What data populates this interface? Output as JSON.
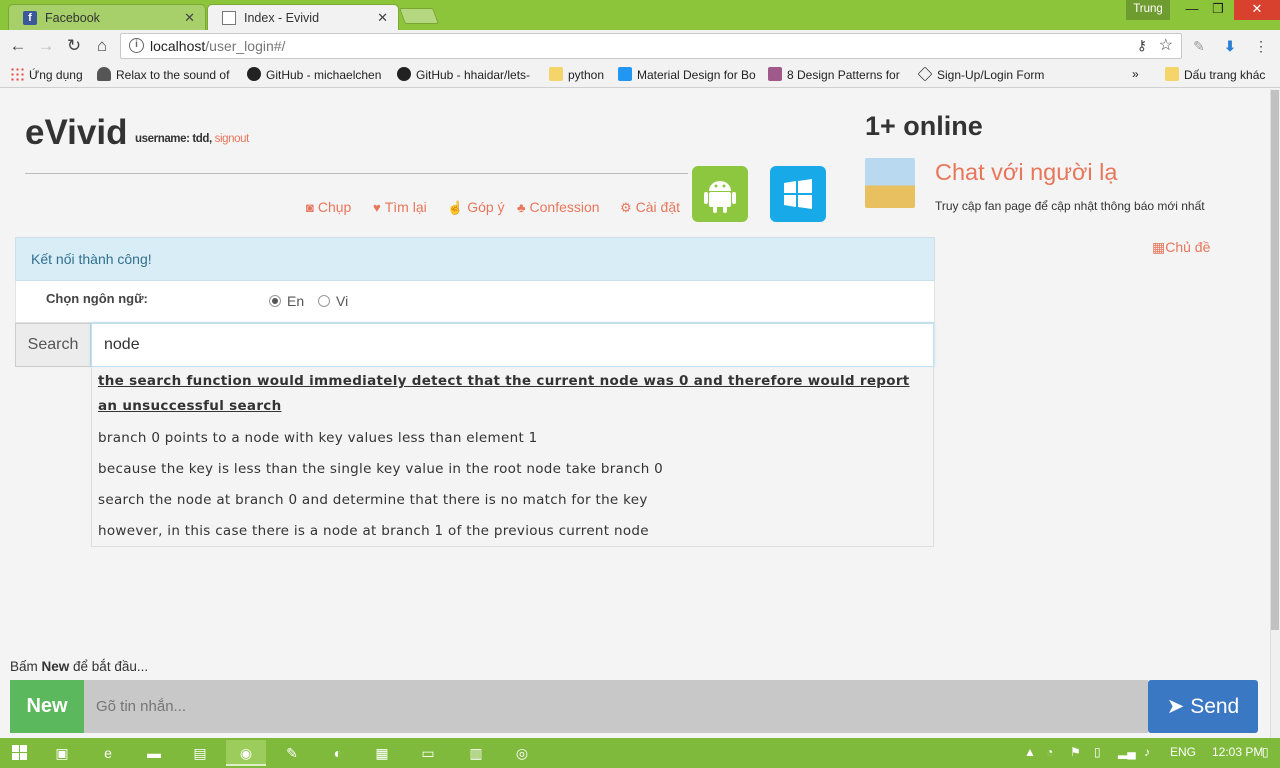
{
  "browser": {
    "tabs": [
      {
        "label": "Facebook",
        "icon": "facebook-icon",
        "active": false
      },
      {
        "label": "Index - Evivid",
        "icon": "document-icon",
        "active": true
      }
    ],
    "profile_name": "Trung",
    "address": {
      "host": "localhost",
      "path": "/user_login#/"
    },
    "bookmarks": [
      {
        "label": "Ứng dụng",
        "icon": "apps-icon"
      },
      {
        "label": "Relax to the sound of",
        "icon": "relax-icon"
      },
      {
        "label": "GitHub - michaelchen",
        "icon": "github-icon"
      },
      {
        "label": "GitHub - hhaidar/lets-",
        "icon": "github-icon"
      },
      {
        "label": "python",
        "icon": "folder-icon"
      },
      {
        "label": "Material Design for Bo",
        "icon": "material-icon"
      },
      {
        "label": "8 Design Patterns for",
        "icon": "design-patterns-icon"
      },
      {
        "label": "Sign-Up/Login Form",
        "icon": "codepen-icon"
      }
    ],
    "bookmarks_more": "»",
    "other_bookmarks": "Dấu trang khác"
  },
  "header": {
    "brand": "eVivid",
    "username_label": "username: tdd,",
    "signout": "signout",
    "menu": [
      {
        "label": "Chụp",
        "icon": "camera-icon"
      },
      {
        "label": "Tìm lại",
        "icon": "heart-icon"
      },
      {
        "label": "Góp ý",
        "icon": "thumbs-up-icon"
      },
      {
        "label": "Confession",
        "icon": "tree-icon"
      },
      {
        "label": "Cài đặt",
        "icon": "gear-icon"
      }
    ]
  },
  "sidebar": {
    "online": "1+ online",
    "chat_title": "Chat với người lạ",
    "chat_subtitle": "Truy cập fan page để cập nhật thông báo mới nhất",
    "topics": "Chủ đề"
  },
  "main": {
    "alert": "Kết nối thành công!",
    "language_label": "Chọn ngôn ngữ:",
    "languages": [
      {
        "label": "En",
        "selected": true
      },
      {
        "label": "Vi",
        "selected": false
      }
    ],
    "search_button": "Search",
    "search_value": "node",
    "suggestions": [
      "the search function would immediately detect that the current node was 0 and therefore would report an unsuccessful search",
      "branch 0 points to a node with key values less than element 1",
      "because the key is less than the single key value in the root node take branch 0",
      "search the node at branch 0 and determine that there is no match for the key",
      "however, in this case there is a node at branch 1 of the previous current node"
    ]
  },
  "chat": {
    "prompt_pre": "Bấm ",
    "prompt_bold": "New",
    "prompt_post": " để bắt đầu...",
    "new_button": "New",
    "message_placeholder": "Gõ tin nhắn...",
    "send_button": "Send"
  },
  "taskbar": {
    "language": "ENG",
    "time": "12:03 PM"
  },
  "colors": {
    "accent": "#e8765b",
    "chrome_green": "#8cc43a",
    "alert_bg": "#d9edf7",
    "new_button": "#5cb85c",
    "send_button": "#3b78c4"
  }
}
